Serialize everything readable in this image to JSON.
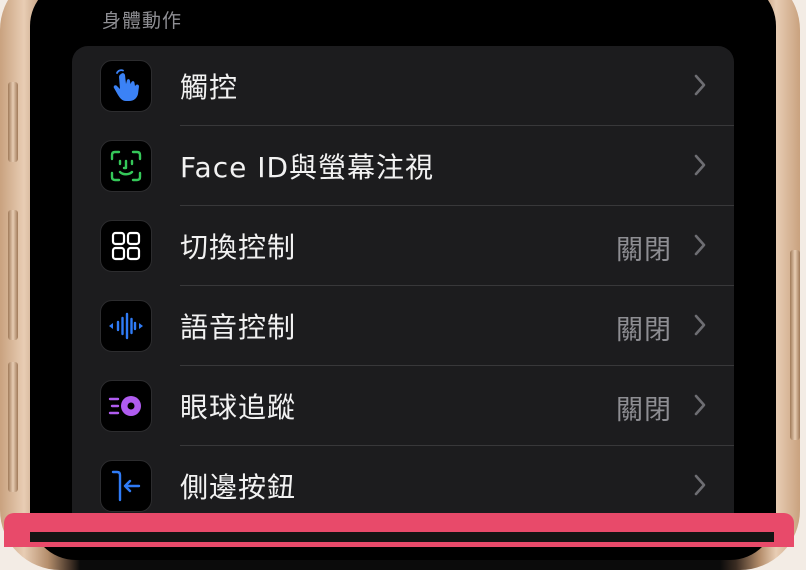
{
  "section": {
    "title": "身體動作"
  },
  "rows": [
    {
      "label": "觸控",
      "value": "",
      "icon": "hand-pointer-icon",
      "icon_color": "#3b82f6"
    },
    {
      "label": "Face ID與螢幕注視",
      "value": "",
      "icon": "face-id-icon",
      "icon_color": "#35c759"
    },
    {
      "label": "切換控制",
      "value": "關閉",
      "icon": "switch-grid-icon",
      "icon_color": "#ffffff"
    },
    {
      "label": "語音控制",
      "value": "關閉",
      "icon": "voice-waveform-icon",
      "icon_color": "#2f7bf6"
    },
    {
      "label": "眼球追蹤",
      "value": "關閉",
      "icon": "eye-tracking-icon",
      "icon_color": "#b05cf0"
    },
    {
      "label": "側邊按鈕",
      "value": "",
      "icon": "side-button-icon",
      "icon_color": "#2f7bf6"
    }
  ],
  "colors": {
    "highlight_bar": "#e84a6a",
    "chevron": "#6d6d72"
  }
}
